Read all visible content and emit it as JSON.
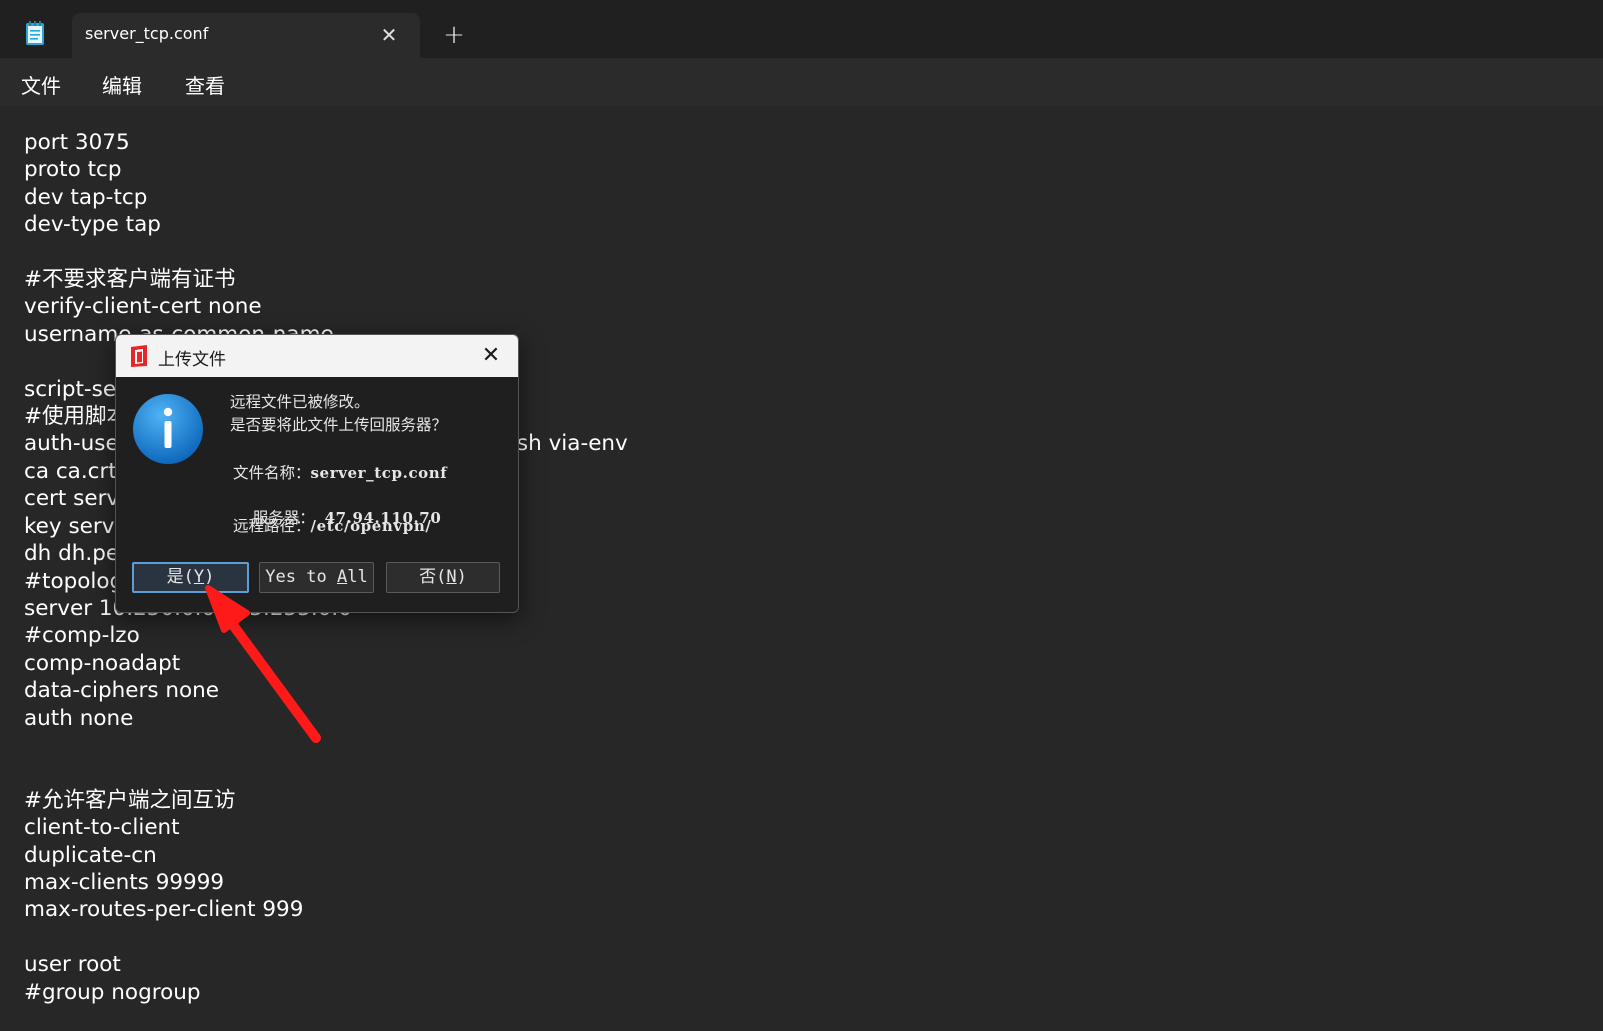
{
  "window": {
    "tab_title": "server_tcp.conf",
    "tab_close_glyph": "✕",
    "new_tab_glyph": "+"
  },
  "menu": {
    "file": "文件",
    "edit": "编辑",
    "view": "查看"
  },
  "editor": {
    "text": "port 3075\nproto tcp\ndev tap-tcp\ndev-type tap\n\n#不要求客户端有证书\nverify-client-cert none\nusername-as-common-name\n\nscript-security 3\n#使用脚本验证用户名密码\nauth-user-pass-verify /etc/openvpn/checkpsw.sh via-env\nca ca.crt\ncert server.crt\nkey server.key\ndh dh.pem\n#topology subnet\nserver 10.250.0.0 255.255.0.0\n#comp-lzo\ncomp-noadapt\ndata-ciphers none\nauth none\n\n\n#允许客户端之间互访\nclient-to-client\nduplicate-cn\nmax-clients 99999\nmax-routes-per-client 999\n\nuser root\n#group nogroup"
  },
  "dialog": {
    "title": "上传文件",
    "close_glyph": "✕",
    "icon": "info-icon",
    "message_line1": "远程文件已被修改。",
    "message_line2": "是否要将此文件上传回服务器？",
    "filename_label": "文件名称：",
    "filename_value": "server_tcp.conf",
    "server_label": "服务器：  ",
    "server_value": "47.94.110.70",
    "path_label": "远程路径：",
    "path_value": "/etc/openvpn/",
    "buttons": {
      "yes_text": "是(",
      "yes_key": "Y",
      "yes_end": ")",
      "yes_all_text": "Yes to ",
      "yes_all_key": "A",
      "yes_all_end": "ll",
      "no_text": "否(",
      "no_key": "N",
      "no_end": ")"
    }
  },
  "colors": {
    "background": "#272727",
    "titlebar": "#202020",
    "annotation_arrow": "#ff1a1a",
    "info_icon": "#1a86d6",
    "default_button_border": "#5e9ed6"
  }
}
